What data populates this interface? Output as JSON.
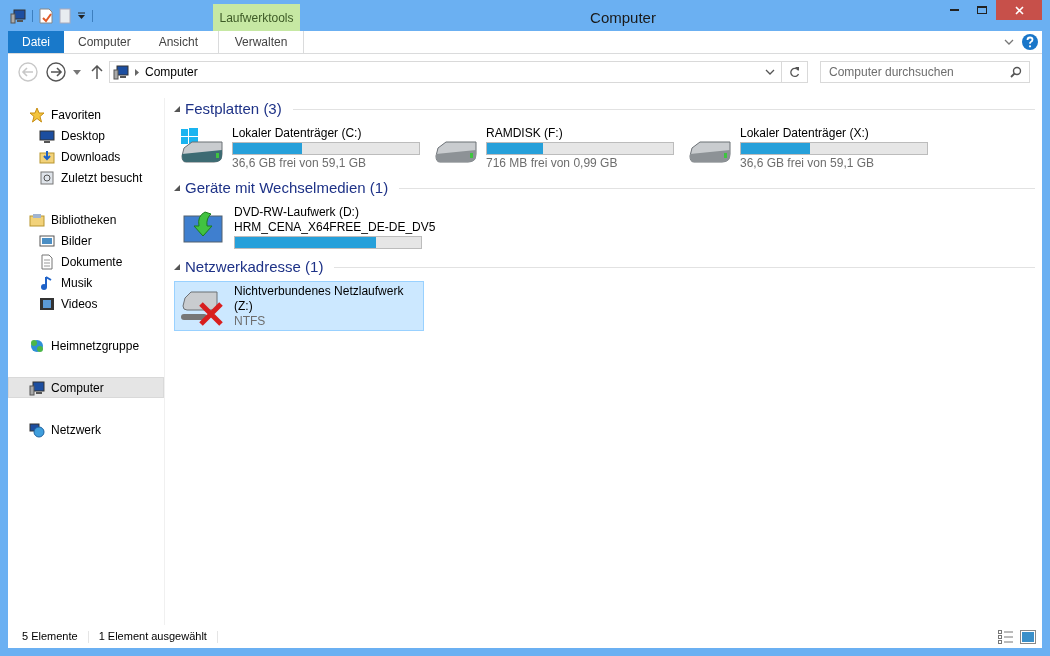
{
  "window": {
    "title": "Computer"
  },
  "ribbon": {
    "context_label": "Laufwerktools",
    "tabs": [
      {
        "label": "Datei",
        "kind": "file"
      },
      {
        "label": "Computer",
        "kind": "tab"
      },
      {
        "label": "Ansicht",
        "kind": "tab"
      },
      {
        "label": "Verwalten",
        "kind": "context"
      }
    ]
  },
  "address_bar": {
    "path": "Computer",
    "search_placeholder": "Computer durchsuchen"
  },
  "sidebar": {
    "groups": [
      {
        "label": "Favoriten",
        "selected": false,
        "children": [
          {
            "label": "Desktop",
            "selected": false
          },
          {
            "label": "Downloads",
            "selected": false
          },
          {
            "label": "Zuletzt besucht",
            "selected": false
          }
        ]
      },
      {
        "label": "Bibliotheken",
        "selected": false,
        "children": [
          {
            "label": "Bilder",
            "selected": false
          },
          {
            "label": "Dokumente",
            "selected": false
          },
          {
            "label": "Musik",
            "selected": false
          },
          {
            "label": "Videos",
            "selected": false
          }
        ]
      },
      {
        "label": "Heimnetzgruppe",
        "selected": false
      },
      {
        "label": "Computer",
        "selected": true
      },
      {
        "label": "Netzwerk",
        "selected": false
      }
    ]
  },
  "groups": [
    {
      "title": "Festplatten (3)",
      "items": [
        {
          "kind": "system-drive",
          "name": "Lokaler Datenträger (C:)",
          "level": 0.37,
          "detail": "36,6 GB frei von 59,1 GB",
          "selected": false
        },
        {
          "kind": "drive",
          "name": "RAMDISK (F:)",
          "level": 0.3,
          "detail": "716 MB frei von 0,99 GB",
          "selected": false
        },
        {
          "kind": "drive",
          "name": "Lokaler Datenträger (X:)",
          "level": 0.37,
          "detail": "36,6 GB frei von 59,1 GB",
          "selected": false
        }
      ]
    },
    {
      "title": "Geräte mit Wechselmedien (1)",
      "items": [
        {
          "kind": "dvd",
          "name": "DVD-RW-Laufwerk (D:)",
          "label": "HRM_CENA_X64FREE_DE-DE_DV5",
          "level": 0.76,
          "selected": false
        }
      ]
    },
    {
      "title": "Netzwerkadresse (1)",
      "items": [
        {
          "kind": "network",
          "name": "Nichtverbundenes Netzlaufwerk (Z:)",
          "detail": "NTFS",
          "selected": true
        }
      ]
    }
  ],
  "status_bar": {
    "count": "5 Elemente",
    "selection": "1 Element ausgewählt"
  }
}
